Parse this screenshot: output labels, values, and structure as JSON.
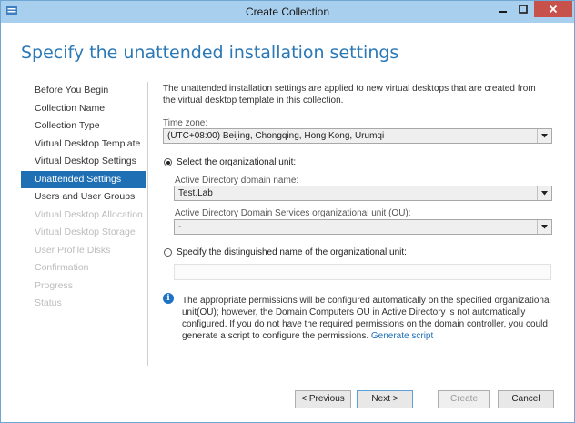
{
  "window": {
    "title": "Create Collection"
  },
  "heading": "Specify the unattended installation settings",
  "nav": {
    "items": [
      {
        "label": "Before You Begin",
        "state": "normal"
      },
      {
        "label": "Collection Name",
        "state": "normal"
      },
      {
        "label": "Collection Type",
        "state": "normal"
      },
      {
        "label": "Virtual Desktop Template",
        "state": "normal"
      },
      {
        "label": "Virtual Desktop Settings",
        "state": "normal"
      },
      {
        "label": "Unattended Settings",
        "state": "active"
      },
      {
        "label": "Users and User Groups",
        "state": "normal"
      },
      {
        "label": "Virtual Desktop Allocation",
        "state": "disabled"
      },
      {
        "label": "Virtual Desktop Storage",
        "state": "disabled"
      },
      {
        "label": "User Profile Disks",
        "state": "disabled"
      },
      {
        "label": "Confirmation",
        "state": "disabled"
      },
      {
        "label": "Progress",
        "state": "disabled"
      },
      {
        "label": "Status",
        "state": "disabled"
      }
    ]
  },
  "main": {
    "description": "The unattended installation settings are applied to new virtual desktops that are created from the virtual desktop template in this collection.",
    "timezone": {
      "label": "Time zone:",
      "value": "(UTC+08:00) Beijing, Chongqing, Hong Kong, Urumqi"
    },
    "option_ou": {
      "label": "Select the organizational unit:",
      "selected": true,
      "domain_label": "Active Directory domain name:",
      "domain_value": "Test.Lab",
      "ou_label": "Active Directory Domain Services organizational unit (OU):",
      "ou_value": "-"
    },
    "option_dn": {
      "label": "Specify the distinguished name of the organizational unit:",
      "selected": false,
      "value": ""
    },
    "info_text": "The appropriate permissions will be configured automatically on the specified organizational unit(OU); however, the Domain Computers OU in Active Directory is not automatically configured. If you do not have the required permissions on the domain controller, you could generate a script to configure the permissions.",
    "info_link": "Generate script"
  },
  "footer": {
    "previous": "< Previous",
    "next": "Next >",
    "create": "Create",
    "cancel": "Cancel"
  },
  "colors": {
    "accent": "#1f6fb5",
    "titlebar": "#a9cfee",
    "close": "#c7514b",
    "heading": "#2b78b6"
  }
}
